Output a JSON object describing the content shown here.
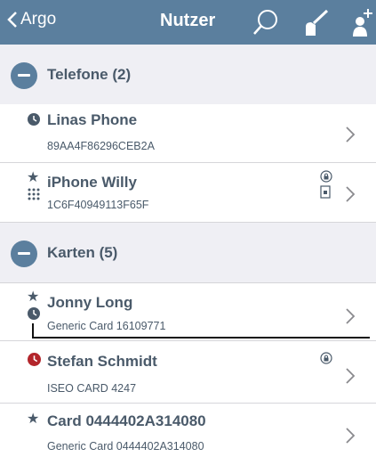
{
  "navbar": {
    "back_label": "Argo",
    "title": "Nutzer"
  },
  "sections": [
    {
      "title": "Telefone (2)"
    },
    {
      "title": "Karten (5)"
    }
  ],
  "phones": [
    {
      "name": "Linas Phone",
      "id": "89AA4F86296CEB2A"
    },
    {
      "name": "iPhone Willy",
      "id": "1C6F40949113F65F"
    }
  ],
  "cards": [
    {
      "name": "Jonny Long",
      "id": "Generic Card 16109771"
    },
    {
      "name": "Stefan Schmidt",
      "id": "ISEO CARD 4247"
    },
    {
      "name": "Card 0444402A314080",
      "id": "Generic Card 0444402A314080"
    }
  ],
  "colors": {
    "navbar": "#5b7f9e",
    "text": "#4a5a6a",
    "alert": "#b3252b",
    "section_bg": "#efeff4"
  },
  "icons": [
    "chevron-left-icon",
    "search-icon",
    "broom-icon",
    "add-user-icon",
    "minus-circle-icon",
    "clock-icon",
    "star-icon",
    "keypad-icon",
    "lock-icon",
    "card-icon",
    "chevron-right-icon"
  ]
}
